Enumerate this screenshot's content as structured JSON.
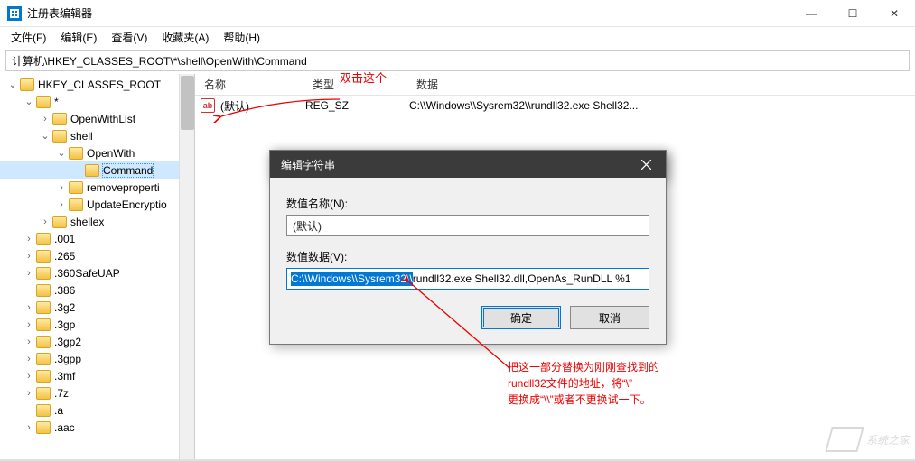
{
  "window": {
    "title": "注册表编辑器",
    "minimize": "—",
    "maximize": "☐",
    "close": "✕"
  },
  "menu": {
    "file": "文件(F)",
    "edit": "编辑(E)",
    "view": "查看(V)",
    "favorites": "收藏夹(A)",
    "help": "帮助(H)"
  },
  "address": "计算机\\HKEY_CLASSES_ROOT\\*\\shell\\OpenWith\\Command",
  "tree": [
    {
      "indent": 0,
      "exp": "down",
      "label": "HKEY_CLASSES_ROOT",
      "sel": false
    },
    {
      "indent": 1,
      "exp": "down",
      "label": "*",
      "sel": false
    },
    {
      "indent": 2,
      "exp": "right",
      "label": "OpenWithList",
      "sel": false
    },
    {
      "indent": 2,
      "exp": "down",
      "label": "shell",
      "sel": false
    },
    {
      "indent": 3,
      "exp": "down",
      "label": "OpenWith",
      "sel": false
    },
    {
      "indent": 4,
      "exp": "",
      "label": "Command",
      "sel": true
    },
    {
      "indent": 3,
      "exp": "right",
      "label": "removeproperti",
      "sel": false
    },
    {
      "indent": 3,
      "exp": "right",
      "label": "UpdateEncryptio",
      "sel": false
    },
    {
      "indent": 2,
      "exp": "right",
      "label": "shellex",
      "sel": false
    },
    {
      "indent": 1,
      "exp": "right",
      "label": ".001",
      "sel": false
    },
    {
      "indent": 1,
      "exp": "right",
      "label": ".265",
      "sel": false
    },
    {
      "indent": 1,
      "exp": "right",
      "label": ".360SafeUAP",
      "sel": false
    },
    {
      "indent": 1,
      "exp": "",
      "label": ".386",
      "sel": false
    },
    {
      "indent": 1,
      "exp": "right",
      "label": ".3g2",
      "sel": false
    },
    {
      "indent": 1,
      "exp": "right",
      "label": ".3gp",
      "sel": false
    },
    {
      "indent": 1,
      "exp": "right",
      "label": ".3gp2",
      "sel": false
    },
    {
      "indent": 1,
      "exp": "right",
      "label": ".3gpp",
      "sel": false
    },
    {
      "indent": 1,
      "exp": "right",
      "label": ".3mf",
      "sel": false
    },
    {
      "indent": 1,
      "exp": "right",
      "label": ".7z",
      "sel": false
    },
    {
      "indent": 1,
      "exp": "",
      "label": ".a",
      "sel": false
    },
    {
      "indent": 1,
      "exp": "right",
      "label": ".aac",
      "sel": false
    }
  ],
  "list": {
    "headers": {
      "name": "名称",
      "type": "类型",
      "data": "数据"
    },
    "row": {
      "icon": "ab",
      "name": "(默认)",
      "type": "REG_SZ",
      "data": "C:\\\\Windows\\\\Sysrem32\\\\rundll32.exe Shell32..."
    }
  },
  "annotations": {
    "top": "双击这个",
    "bottom_l1": "把这一部分替换为刚刚查找到的",
    "bottom_l2": "rundll32文件的地址，将“\\”",
    "bottom_l3": "更换成“\\\\”或者不更换试一下。"
  },
  "dialog": {
    "title": "编辑字符串",
    "name_label": "数值名称(N):",
    "name_value": "(默认)",
    "data_label": "数值数据(V):",
    "data_selected": "C:\\\\Windows\\\\Sysrem32\\\\",
    "data_rest": "rundll32.exe Shell32.dll,OpenAs_RunDLL %1",
    "ok": "确定",
    "cancel": "取消"
  },
  "watermark": "系统之家"
}
